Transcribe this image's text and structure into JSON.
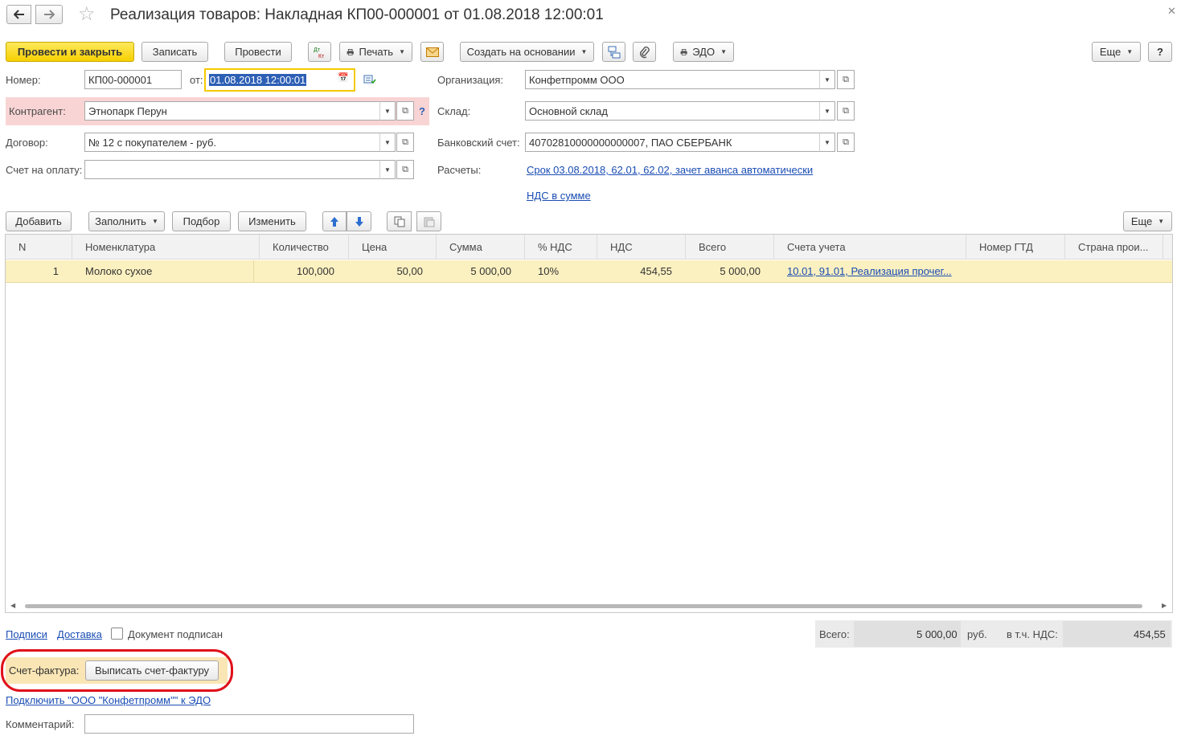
{
  "window": {
    "title": "Реализация товаров: Накладная КП00-000001 от 01.08.2018 12:00:01"
  },
  "toolbar": {
    "post_close": "Провести и закрыть",
    "save": "Записать",
    "post": "Провести",
    "dtkt": "Дт/Кт",
    "print": "Печать",
    "create_based": "Создать на основании",
    "edo": "ЭДО",
    "more": "Еще",
    "help": "?"
  },
  "form": {
    "number_label": "Номер:",
    "number_value": "КП00-000001",
    "date_label": "от:",
    "date_value": "01.08.2018 12:00:01",
    "org_label": "Организация:",
    "org_value": "Конфетпромм ООО",
    "contractor_label": "Контрагент:",
    "contractor_value": "Этнопарк Перун",
    "warehouse_label": "Склад:",
    "warehouse_value": "Основной склад",
    "contract_label": "Договор:",
    "contract_value": "№ 12 с покупателем - руб.",
    "bank_label": "Банковский счет:",
    "bank_value": "40702810000000000007, ПАО СБЕРБАНК",
    "invoice_label": "Счет на оплату:",
    "invoice_value": "",
    "settlements_label": "Расчеты:",
    "settlements_link": "Срок 03.08.2018, 62.01, 62.02, зачет аванса автоматически",
    "vat_link": "НДС в сумме"
  },
  "table_toolbar": {
    "add": "Добавить",
    "fill": "Заполнить",
    "pick": "Подбор",
    "change": "Изменить",
    "more": "Еще"
  },
  "table": {
    "columns": [
      "N",
      "Номенклатура",
      "Количество",
      "Цена",
      "Сумма",
      "% НДС",
      "НДС",
      "Всего",
      "Счета учета",
      "Номер ГТД",
      "Страна прои..."
    ],
    "rows": [
      {
        "n": "1",
        "item": "Молоко сухое",
        "qty": "100,000",
        "price": "50,00",
        "sum": "5 000,00",
        "vat_rate": "10%",
        "vat": "454,55",
        "total": "5 000,00",
        "accounts": "10.01, 91.01, Реализация прочег...",
        "gtd": "",
        "country": ""
      }
    ]
  },
  "footer": {
    "signatures_link": "Подписи",
    "delivery_link": "Доставка",
    "signed_label": "Документ подписан",
    "total_label": "Всего:",
    "total_value": "5 000,00",
    "currency": "руб.",
    "vat_incl_label": "в т.ч. НДС:",
    "vat_incl_value": "454,55",
    "sf_label": "Счет-фактура:",
    "sf_button": "Выписать счет-фактуру",
    "edo_link": "Подключить \"ООО \"Конфетпромм\"\" к ЭДО",
    "comment_label": "Комментарий:",
    "comment_value": ""
  },
  "colors": {
    "accent_yellow": "#f6d000",
    "link_blue": "#1a4db3",
    "error_pink": "#f9d4d4",
    "row_selected": "#fbf0c0",
    "annotation_red": "#e0101a"
  }
}
